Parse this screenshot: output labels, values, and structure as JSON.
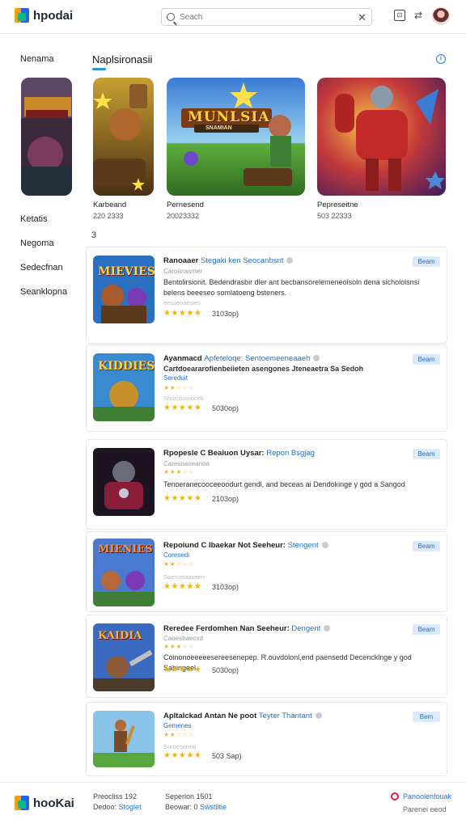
{
  "header": {
    "logo_text": "hpodai",
    "search_placeholder": "Seach",
    "clear_glyph": "✕"
  },
  "sidebar": {
    "items": [
      {
        "label": "Nenama"
      },
      {
        "label": "Ketatis"
      },
      {
        "label": "Negoma"
      },
      {
        "label": "Sedecfnan"
      },
      {
        "label": "Seanklopna"
      }
    ]
  },
  "featured": {
    "title": "Naplsironasii",
    "cards": [
      {
        "name": "Karbeand",
        "meta": "220 2333"
      },
      {
        "name": "Pernesend",
        "meta": "20023332"
      },
      {
        "name": "Pepreseitne",
        "meta": "503 22333"
      }
    ],
    "banner_text": "MUNLSIA",
    "banner_sub": "SNAMIAN"
  },
  "results": {
    "count": "3",
    "rows": [
      {
        "title": "Ranoaaer",
        "link": "Stegaki ken Seocanbsnt",
        "sub": "Caroisrasmer",
        "desc": "Bentolirsionit. Bedendrasbir dler ant becbansorelemeneolsoln dena sichololsnsi belens beeeseo somlatoeng bsteners.",
        "faint": "eesseoaesies",
        "count": "3103op)",
        "button": "Beam",
        "thumb_text": "MIEVIES"
      },
      {
        "title": "Ayanmacd",
        "link": "Apfeteloqe:  Sentoemeeneaaeh",
        "sub": "",
        "desc": "Cartdoeararofienbeiieten asengones  Jteneaetra Sa Sedoh",
        "desc_link": "Sereduit",
        "faint": "Shorolosoocek",
        "count": "5030op)",
        "button": "Beam",
        "thumb_text": "KIDDIES"
      },
      {
        "title": "Rpopesle C Beaiuon Uysar:",
        "link": "Repon Bsgjag",
        "sub": "Caresnaoeanoa",
        "desc": "Tenoeranecooceeoodurt gendl, and beceas ai Dendokinge y god a Sangod",
        "faint": "",
        "count": "2103op)",
        "button": "Beam",
        "thumb_text": ""
      },
      {
        "title": "Repoiund C Ibaekar Not Seeheur:",
        "link": "Stengent",
        "sub": "Coresedi",
        "desc": "",
        "faint": "Soeroetaaseen",
        "count": "3103op)",
        "button": "Beam",
        "thumb_text": "MIENIES"
      },
      {
        "title": "Reredee Ferdomhen Nan Seeheur:",
        "link": "Dengent",
        "sub": "Caoesbaecsd",
        "desc": "Coinonoeeeeesereesenepep. R.ouvdolonl,end paensedd Decencklnge y god  Sahingeel",
        "faint": "",
        "count": "5030op)",
        "button": "Beam",
        "thumb_text": "KAIDIA"
      },
      {
        "title": "Apltalckad Antan Ne poot",
        "link": "Teyter  Thantant",
        "sub": "Gemenes",
        "desc": "",
        "faint": "Soroesoreal",
        "count": "503 Sap)",
        "button": "Bem",
        "thumb_text": ""
      }
    ],
    "ratings": [
      5,
      5,
      5,
      5,
      5,
      5
    ],
    "faint_ratings": [
      0,
      2,
      2.5,
      2,
      2.5,
      2
    ]
  },
  "footer": {
    "logo_text": "hooKai",
    "col1_line1": "Preocliss  192",
    "col1_line2_a": "Dedoo:",
    "col1_line2_link": "Stoglet",
    "col2_line1": "Seperion  1501",
    "col2_line2_a": "Beowar: 0",
    "col2_line2_link": "Swstiitie",
    "right_link": "Panooienfouak",
    "right_text": "Parenei eeod"
  },
  "colors": {
    "accent": "#1d6fd6",
    "underline": "#1e9bd7",
    "star": "#f5b301"
  }
}
